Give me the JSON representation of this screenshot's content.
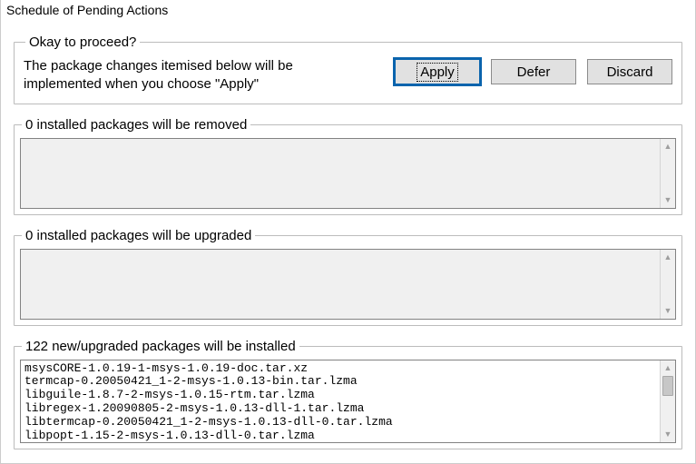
{
  "title": "Schedule of Pending Actions",
  "proceed": {
    "legend": "Okay to proceed?",
    "text": "The package changes itemised below will be implemented when you choose \"Apply\"",
    "apply_label": "Apply",
    "defer_label": "Defer",
    "discard_label": "Discard"
  },
  "removed": {
    "legend": "0 installed packages will be removed",
    "items": []
  },
  "upgraded": {
    "legend": "0 installed packages will be upgraded",
    "items": []
  },
  "installed": {
    "legend": "122 new/upgraded packages will be installed",
    "items": [
      "msysCORE-1.0.19-1-msys-1.0.19-doc.tar.xz",
      "termcap-0.20050421_1-2-msys-1.0.13-bin.tar.lzma",
      "libguile-1.8.7-2-msys-1.0.15-rtm.tar.lzma",
      "libregex-1.20090805-2-msys-1.0.13-dll-1.tar.lzma",
      "libtermcap-0.20050421_1-2-msys-1.0.13-dll-0.tar.lzma",
      "libpopt-1.15-2-msys-1.0.13-dll-0.tar.lzma"
    ]
  }
}
